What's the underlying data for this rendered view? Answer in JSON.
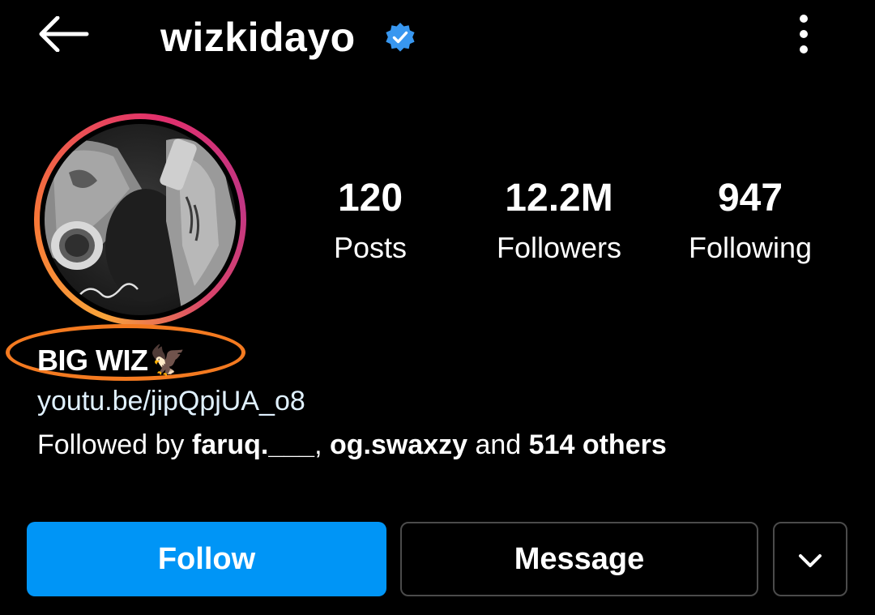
{
  "header": {
    "username": "wizkidayo",
    "verified": true,
    "back_icon": "arrow-left-icon",
    "more_icon": "more-vertical-icon"
  },
  "avatar": {
    "description_icon": "profile-photo",
    "ring_colors": [
      "#f9a43a",
      "#f77737",
      "#e1306c",
      "#c13584"
    ]
  },
  "stats": [
    {
      "value": "120",
      "label": "Posts"
    },
    {
      "value": "12.2M",
      "label": "Followers"
    },
    {
      "value": "947",
      "label": "Following"
    }
  ],
  "bio": {
    "display_name": "BIG WIZ",
    "display_name_emoji": "🦅",
    "link": "youtu.be/jipQpjUA_o8",
    "followed_by_prefix": "Followed by ",
    "followed_by_user1": "faruq.___",
    "followed_by_sep": ", ",
    "followed_by_user2": "og.swaxzy",
    "followed_by_and": " and ",
    "followed_by_others": "514 others"
  },
  "actions": {
    "follow_label": "Follow",
    "message_label": "Message",
    "more_icon": "chevron-down-icon"
  },
  "colors": {
    "background": "#000000",
    "follow_button": "#0095f6",
    "verified_badge": "#3897f0",
    "annotation_oval": "#f47a20",
    "link_text": "#e0f1ff"
  }
}
